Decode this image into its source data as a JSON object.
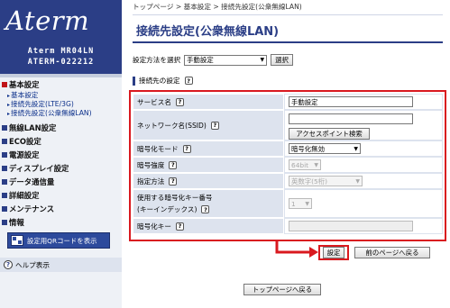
{
  "sidebar": {
    "logo": "Aterm",
    "model_line1": "Aterm MR04LN",
    "model_line2": "ATERM-022212",
    "items": [
      {
        "label": "基本設定"
      },
      {
        "label": "無線LAN設定"
      },
      {
        "label": "ECO設定"
      },
      {
        "label": "電源設定"
      },
      {
        "label": "ディスプレイ設定"
      },
      {
        "label": "データ通信量"
      },
      {
        "label": "詳細設定"
      },
      {
        "label": "メンテナンス"
      },
      {
        "label": "情報"
      }
    ],
    "sub_items": [
      {
        "label": "基本設定"
      },
      {
        "label": "接続先設定(LTE/3G)"
      },
      {
        "label": "接続先設定(公衆無線LAN)"
      }
    ],
    "qr_button": "設定用QRコードを表示",
    "help_label": "ヘルプ表示",
    "help_icon_glyph": "?"
  },
  "breadcrumb": "トップページ > 基本設定 > 接続先設定(公衆無線LAN)",
  "page_title": "接続先設定(公衆無線LAN)",
  "method": {
    "label": "設定方法を選択",
    "value": "手動設定",
    "select_button": "選択"
  },
  "section": {
    "label": "接続先の設定"
  },
  "form": {
    "service_name": {
      "label": "サービス名",
      "value": "手動設定"
    },
    "ssid": {
      "label": "ネットワーク名(SSID)",
      "value": "",
      "ap_search_button": "アクセスポイント検索"
    },
    "encryption_mode": {
      "label": "暗号化モード",
      "value": "暗号化無効"
    },
    "encryption_strength": {
      "label": "暗号強度",
      "value": "64bit"
    },
    "specify_method": {
      "label": "指定方法",
      "value": "英数字(5桁)"
    },
    "key_number": {
      "label_line1": "使用する暗号化キー番号",
      "label_line2": "(キーインデックス)",
      "value": "1"
    },
    "encryption_key": {
      "label": "暗号化キー",
      "value": ""
    }
  },
  "buttons": {
    "set": "設定",
    "back": "前のページへ戻る",
    "top": "トップページへ戻る"
  },
  "help_glyph": "?",
  "colors": {
    "brand": "#2b3e86",
    "highlight_red": "#d9191f",
    "label_bg": "#dde3ee"
  }
}
